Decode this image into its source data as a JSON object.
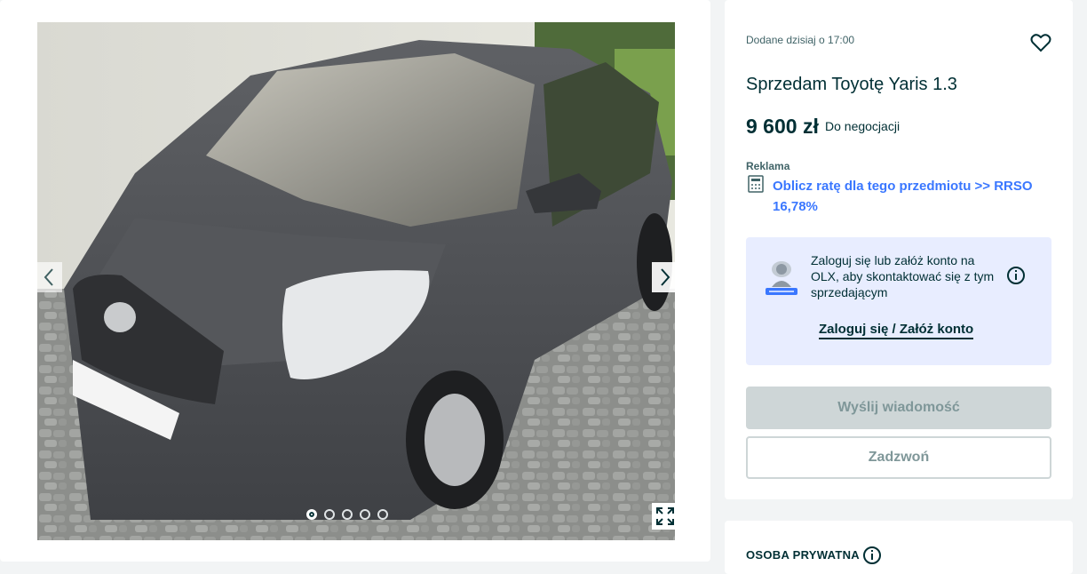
{
  "gallery": {
    "photo_alt": "Sprzedam Toyotę Yaris 1.3",
    "prev_icon": "chevron-left-icon",
    "next_icon": "chevron-right-icon",
    "dots_total": 5,
    "dots_active": 1,
    "expand_icon": "expand-icon"
  },
  "ad": {
    "posted": "Dodane dzisiaj o 17:00",
    "favorite_icon": "heart-icon",
    "title": "Sprzedam Toyotę Yaris 1.3",
    "price": "9 600 zł",
    "negotiable": "Do negocjacji",
    "ad_label": "Reklama",
    "loan_link": "Oblicz ratę dla tego przedmiotu >> RRSO 16,78%"
  },
  "login_prompt": {
    "text": "Zaloguj się lub załóż konto na OLX, aby skontaktować się z tym sprzedającym",
    "link": "Zaloguj się / Załóż konto"
  },
  "actions": {
    "message": "Wyślij wiadomość",
    "call": "Zadzwoń"
  },
  "seller": {
    "type": "OSOBA PRYWATNA"
  },
  "colors": {
    "brand_dark": "#002f34",
    "link_blue": "#3a77ff",
    "login_box_bg": "#e8edff",
    "disabled_button": "#ced6d7"
  }
}
